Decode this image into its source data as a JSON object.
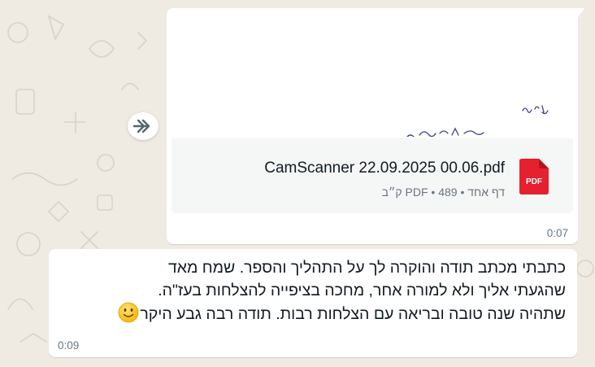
{
  "attachment": {
    "file_name": "CamScanner 22.09.2025 00.06.pdf",
    "file_type_badge": "PDF",
    "meta": "דף אחד • PDF • 489 ק״ב",
    "time": "0:07",
    "icon": "pdf-file-icon",
    "forward_icon": "forward-arrow-icon"
  },
  "message": {
    "lines": [
      "כתבתי מכתב תודה והוקרה לך על התהליך והספר. שמח מאד",
      "שהגעתי אליך ולא למורה אחר, מחכה בציפייה להצלחות בעז\"ה.",
      "שתהיה שנה טובה ובריאה עם הצלחות רבות. תודה רבה גבע היקר"
    ],
    "emoji_icon": "smiling-face-emoji-icon",
    "time": "0:09"
  },
  "colors": {
    "chat_background": "#efeae2",
    "bubble": "#ffffff",
    "file_card": "#f5f6f6",
    "pdf_red": "#e5202f",
    "meta_text": "#667781"
  }
}
